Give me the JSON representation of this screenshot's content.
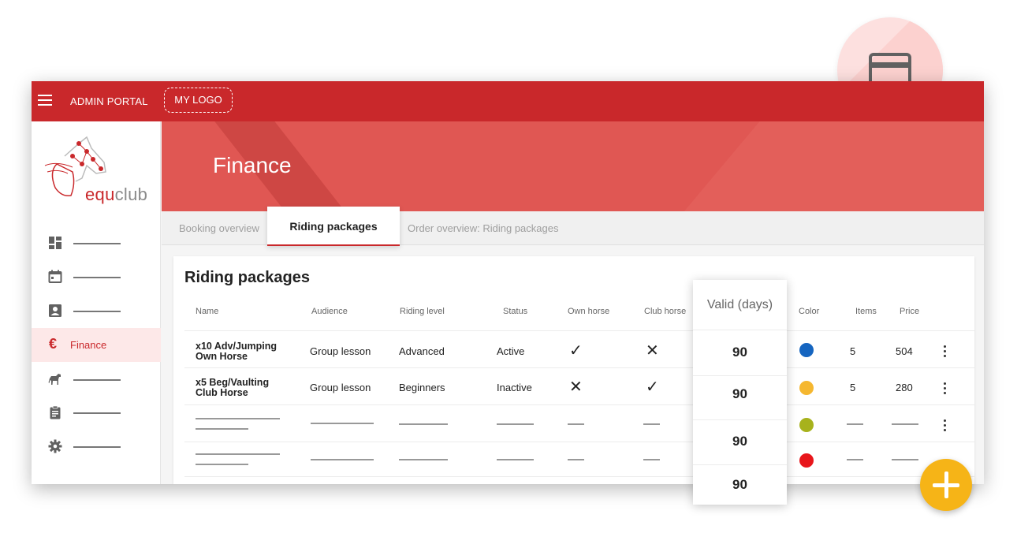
{
  "topbar": {
    "portal_label": "ADMIN PORTAL",
    "logo_placeholder": "MY LOGO"
  },
  "brand": {
    "prefix": "equ",
    "suffix": "club"
  },
  "sidebar": {
    "items": [
      {
        "icon": "dashboard-icon",
        "label": ""
      },
      {
        "icon": "calendar-icon",
        "label": ""
      },
      {
        "icon": "contact-card-icon",
        "label": ""
      },
      {
        "icon": "euro-icon",
        "label": "Finance",
        "active": true
      },
      {
        "icon": "horse-icon",
        "label": ""
      },
      {
        "icon": "clipboard-icon",
        "label": ""
      },
      {
        "icon": "gear-icon",
        "label": ""
      }
    ]
  },
  "hero": {
    "title": "Finance"
  },
  "tabs": [
    {
      "label": "Booking overview"
    },
    {
      "label": "Riding packages",
      "active": true
    },
    {
      "label": "Order overview: Riding packages"
    }
  ],
  "table": {
    "title": "Riding packages",
    "columns": [
      "Name",
      "Audience",
      "Riding level",
      "Status",
      "Own horse",
      "Club horse",
      "Valid (days)",
      "Color",
      "Items",
      "Price"
    ],
    "rows": [
      {
        "name_line1": "x10 Adv/Jumping",
        "name_line2": "Own Horse",
        "audience": "Group lesson",
        "level": "Advanced",
        "status": "Active",
        "own_horse": "✓",
        "club_horse": "✕",
        "valid": "90",
        "color": "#1565c0",
        "items": "5",
        "price": "504"
      },
      {
        "name_line1": "x5 Beg/Vaulting",
        "name_line2": "Club Horse",
        "audience": "Group lesson",
        "level": "Beginners",
        "status": "Inactive",
        "own_horse": "✕",
        "club_horse": "✓",
        "valid": "90",
        "color": "#f5b730",
        "items": "5",
        "price": "280"
      },
      {
        "valid": "90",
        "color": "#a7b21c"
      },
      {
        "valid": "90",
        "color": "#e8161b"
      }
    ]
  },
  "colors": {
    "primary": "#c9282b",
    "hero": "#e05753",
    "accent": "#f6b417"
  }
}
